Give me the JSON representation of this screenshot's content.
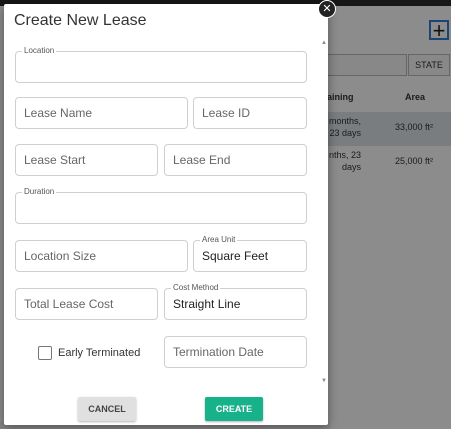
{
  "dialog": {
    "title": "Create New Lease",
    "fields": {
      "location": {
        "label": "Location",
        "value": ""
      },
      "lease_name": {
        "placeholder": "Lease Name"
      },
      "lease_id": {
        "placeholder": "Lease ID"
      },
      "lease_start": {
        "placeholder": "Lease Start"
      },
      "lease_end": {
        "placeholder": "Lease End"
      },
      "duration": {
        "label": "Duration",
        "value": ""
      },
      "location_size": {
        "placeholder": "Location Size"
      },
      "area_unit": {
        "label": "Area Unit",
        "value": "Square Feet"
      },
      "total_lease_cost": {
        "placeholder": "Total Lease Cost"
      },
      "cost_method": {
        "label": "Cost Method",
        "value": "Straight Line"
      },
      "early_terminated": {
        "label": "Early Terminated",
        "checked": false
      },
      "termination_date": {
        "placeholder": "Termination Date"
      }
    },
    "buttons": {
      "cancel": "CANCEL",
      "create": "CREATE"
    },
    "colors": {
      "create": "#17b18a",
      "cancel": "#e0e0e0"
    }
  },
  "background": {
    "add_icon": "+",
    "state_button": "STATE",
    "table": {
      "headers": {
        "remaining": "aining",
        "area": "Area"
      },
      "rows": [
        {
          "remaining_line1": "months,",
          "remaining_line2": "23 days",
          "area": "33,000 ft²"
        },
        {
          "remaining_line1": "nths, 23",
          "remaining_line2": "days",
          "area": "25,000 ft²"
        }
      ]
    }
  }
}
